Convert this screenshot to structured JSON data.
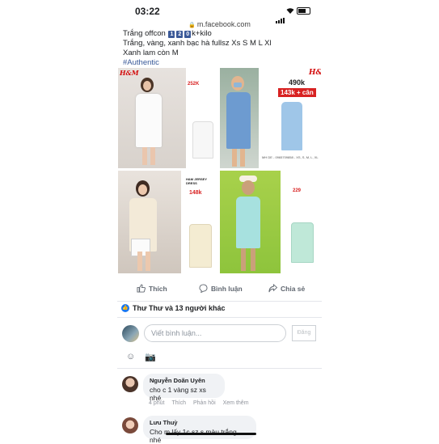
{
  "status_bar": {
    "time": "03:22",
    "url": "m.facebook.com"
  },
  "post": {
    "caption_line1_prefix": "Trắng offcon",
    "caption_keycaps": [
      "1",
      "2",
      "0"
    ],
    "caption_line1_suffix": "k+kilo",
    "caption_line2": "Trắng, vàng, xanh bạc hà fullsz Xs S M L Xl",
    "caption_line3": "Xanh lam còn M",
    "hashtag": "#Authentic"
  },
  "images": {
    "top_left_price": "252K",
    "top_right_price": "490k",
    "top_right_tag": "143k + cân",
    "top_right_sizes": "MH DE - 0965709858 - XS, S, M, L, XL",
    "bottom_left_title": "H&M JERSEY DRESS",
    "bottom_left_price": "148k",
    "bottom_right_price": "229",
    "brand": "H&M"
  },
  "actions": {
    "like": "Thích",
    "comment": "Bình luận",
    "share": "Chia sẻ"
  },
  "reactions": {
    "text": "Thư Thư và 13 người khác"
  },
  "composer": {
    "placeholder": "Viết bình luận...",
    "post_label": "Đăng"
  },
  "comments": [
    {
      "name": "Nguyễn Doãn Uyên",
      "text": "cho c 1 vàng sz xs nhé",
      "time": "4 phút",
      "like": "Thích",
      "reply": "Phản hồi",
      "more": "Xem thêm"
    },
    {
      "name": "Lưu Thuỳ",
      "text": "Cho m lấy 1c sz s màu trắng nhé"
    }
  ]
}
